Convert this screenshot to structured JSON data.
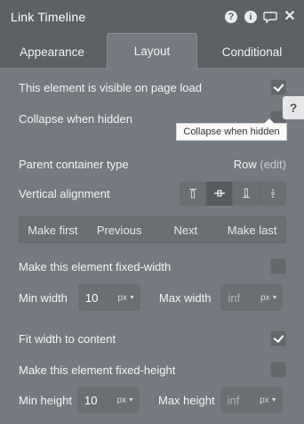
{
  "header": {
    "title": "Link Timeline"
  },
  "tabs": [
    {
      "label": "Appearance"
    },
    {
      "label": "Layout"
    },
    {
      "label": "Conditional"
    }
  ],
  "layout": {
    "visible_on_load": {
      "label": "This element is visible on page load",
      "checked": true
    },
    "collapse_when_hidden": {
      "label": "Collapse when hidden",
      "checked": false
    },
    "help_button": "?",
    "tooltip": "Collapse when hidden",
    "parent_container": {
      "label": "Parent container type",
      "value": "Row",
      "edit": "(edit)"
    },
    "vertical_alignment": {
      "label": "Vertical alignment",
      "options": [
        {
          "icon": "align-top-icon",
          "glyph": "⊤"
        },
        {
          "icon": "align-center-icon",
          "glyph": "-⊕-"
        },
        {
          "icon": "align-bottom-icon",
          "glyph": "⊥"
        },
        {
          "icon": "align-stretch-icon",
          "glyph": "⋮"
        }
      ],
      "selected": 1
    },
    "order": [
      "Make first",
      "Previous",
      "Next",
      "Make last"
    ],
    "fixed_width": {
      "label": "Make this element fixed-width",
      "checked": false
    },
    "min_width": {
      "label": "Min width",
      "value": "10",
      "unit": "px"
    },
    "max_width": {
      "label": "Max width",
      "placeholder": "inf",
      "unit": "px"
    },
    "fit_width": {
      "label": "Fit width to content",
      "checked": true
    },
    "fixed_height": {
      "label": "Make this element fixed-height",
      "checked": false
    },
    "min_height": {
      "label": "Min height",
      "value": "10",
      "unit": "px"
    },
    "max_height": {
      "label": "Max height",
      "placeholder": "inf",
      "unit": "px"
    }
  }
}
